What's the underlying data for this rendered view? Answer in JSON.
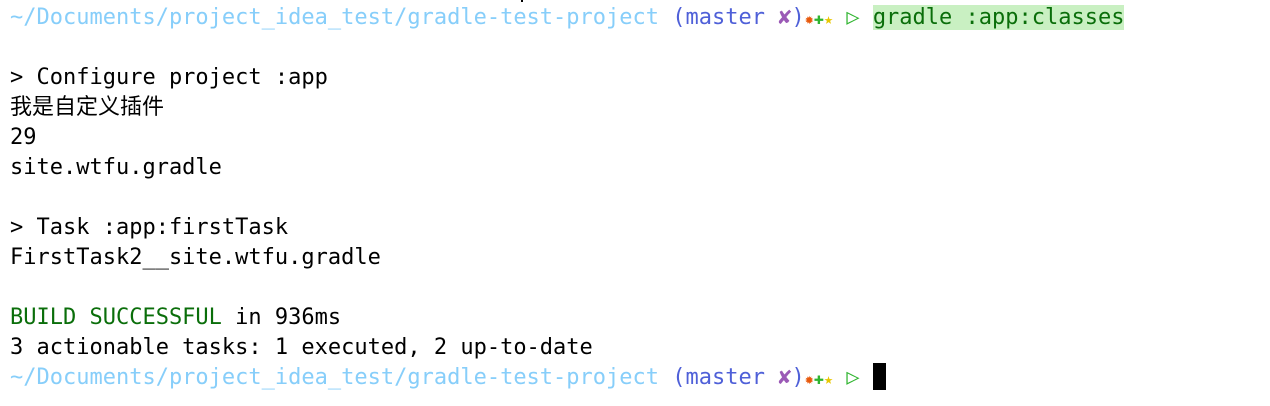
{
  "prompt": {
    "path": "~/Documents/project_idea_test/gradle-test-project",
    "open_paren": "(",
    "branch": "master",
    "dirty_mark": "✘",
    "close_paren": ")",
    "status_star": "✹",
    "status_plus": "✚",
    "status_star2": "★",
    "arrow": "▷"
  },
  "command": "gradle :app:classes",
  "output": {
    "configure_header": "> Configure project :app",
    "plugin_message": "我是自定义插件",
    "sdk_number": "29",
    "package_name": "site.wtfu.gradle",
    "task_header": "> Task :app:firstTask",
    "task_output": "FirstTask2__site.wtfu.gradle",
    "build_status": "BUILD SUCCESSFUL",
    "build_time": " in 936ms",
    "summary": "3 actionable tasks: 1 executed, 2 up-to-date"
  },
  "colors": {
    "path": "#87cefa",
    "branch": "#4f60d8",
    "dirty": "#9b59b6",
    "command_fg": "#0a6e0a",
    "command_bg": "#c9f0c2",
    "success": "#0a6e0a"
  }
}
